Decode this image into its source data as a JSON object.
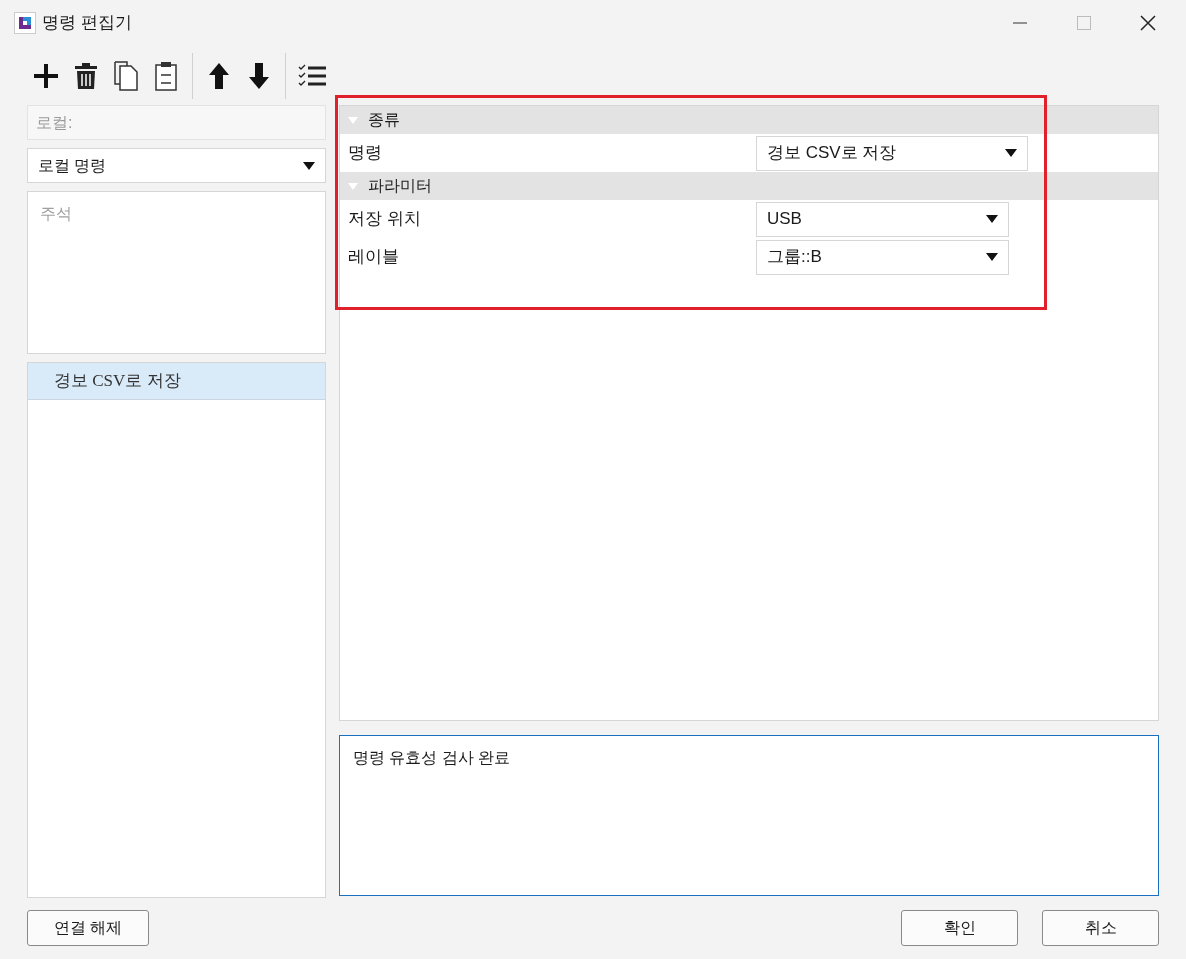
{
  "window": {
    "title": "명령 편집기"
  },
  "left": {
    "local_field": {
      "placeholder": "로컬:"
    },
    "scope_select": {
      "value": "로컬 명령"
    },
    "comment": {
      "placeholder": "주석"
    },
    "commands": [
      {
        "label": "경보 CSV로 저장",
        "selected": true
      }
    ]
  },
  "properties": {
    "categories": [
      {
        "label": "종류",
        "expanded": true,
        "rows": [
          {
            "label": "명령",
            "value": "경보 CSV로 저장"
          }
        ]
      },
      {
        "label": "파라미터",
        "expanded": true,
        "rows": [
          {
            "label": "저장 위치",
            "value": "USB"
          },
          {
            "label": "레이블",
            "value": "그룹::B"
          }
        ]
      }
    ]
  },
  "message": "명령 유효성 검사 완료",
  "buttons": {
    "left": [
      "연결 해제"
    ],
    "right": [
      "확인",
      "취소"
    ]
  }
}
